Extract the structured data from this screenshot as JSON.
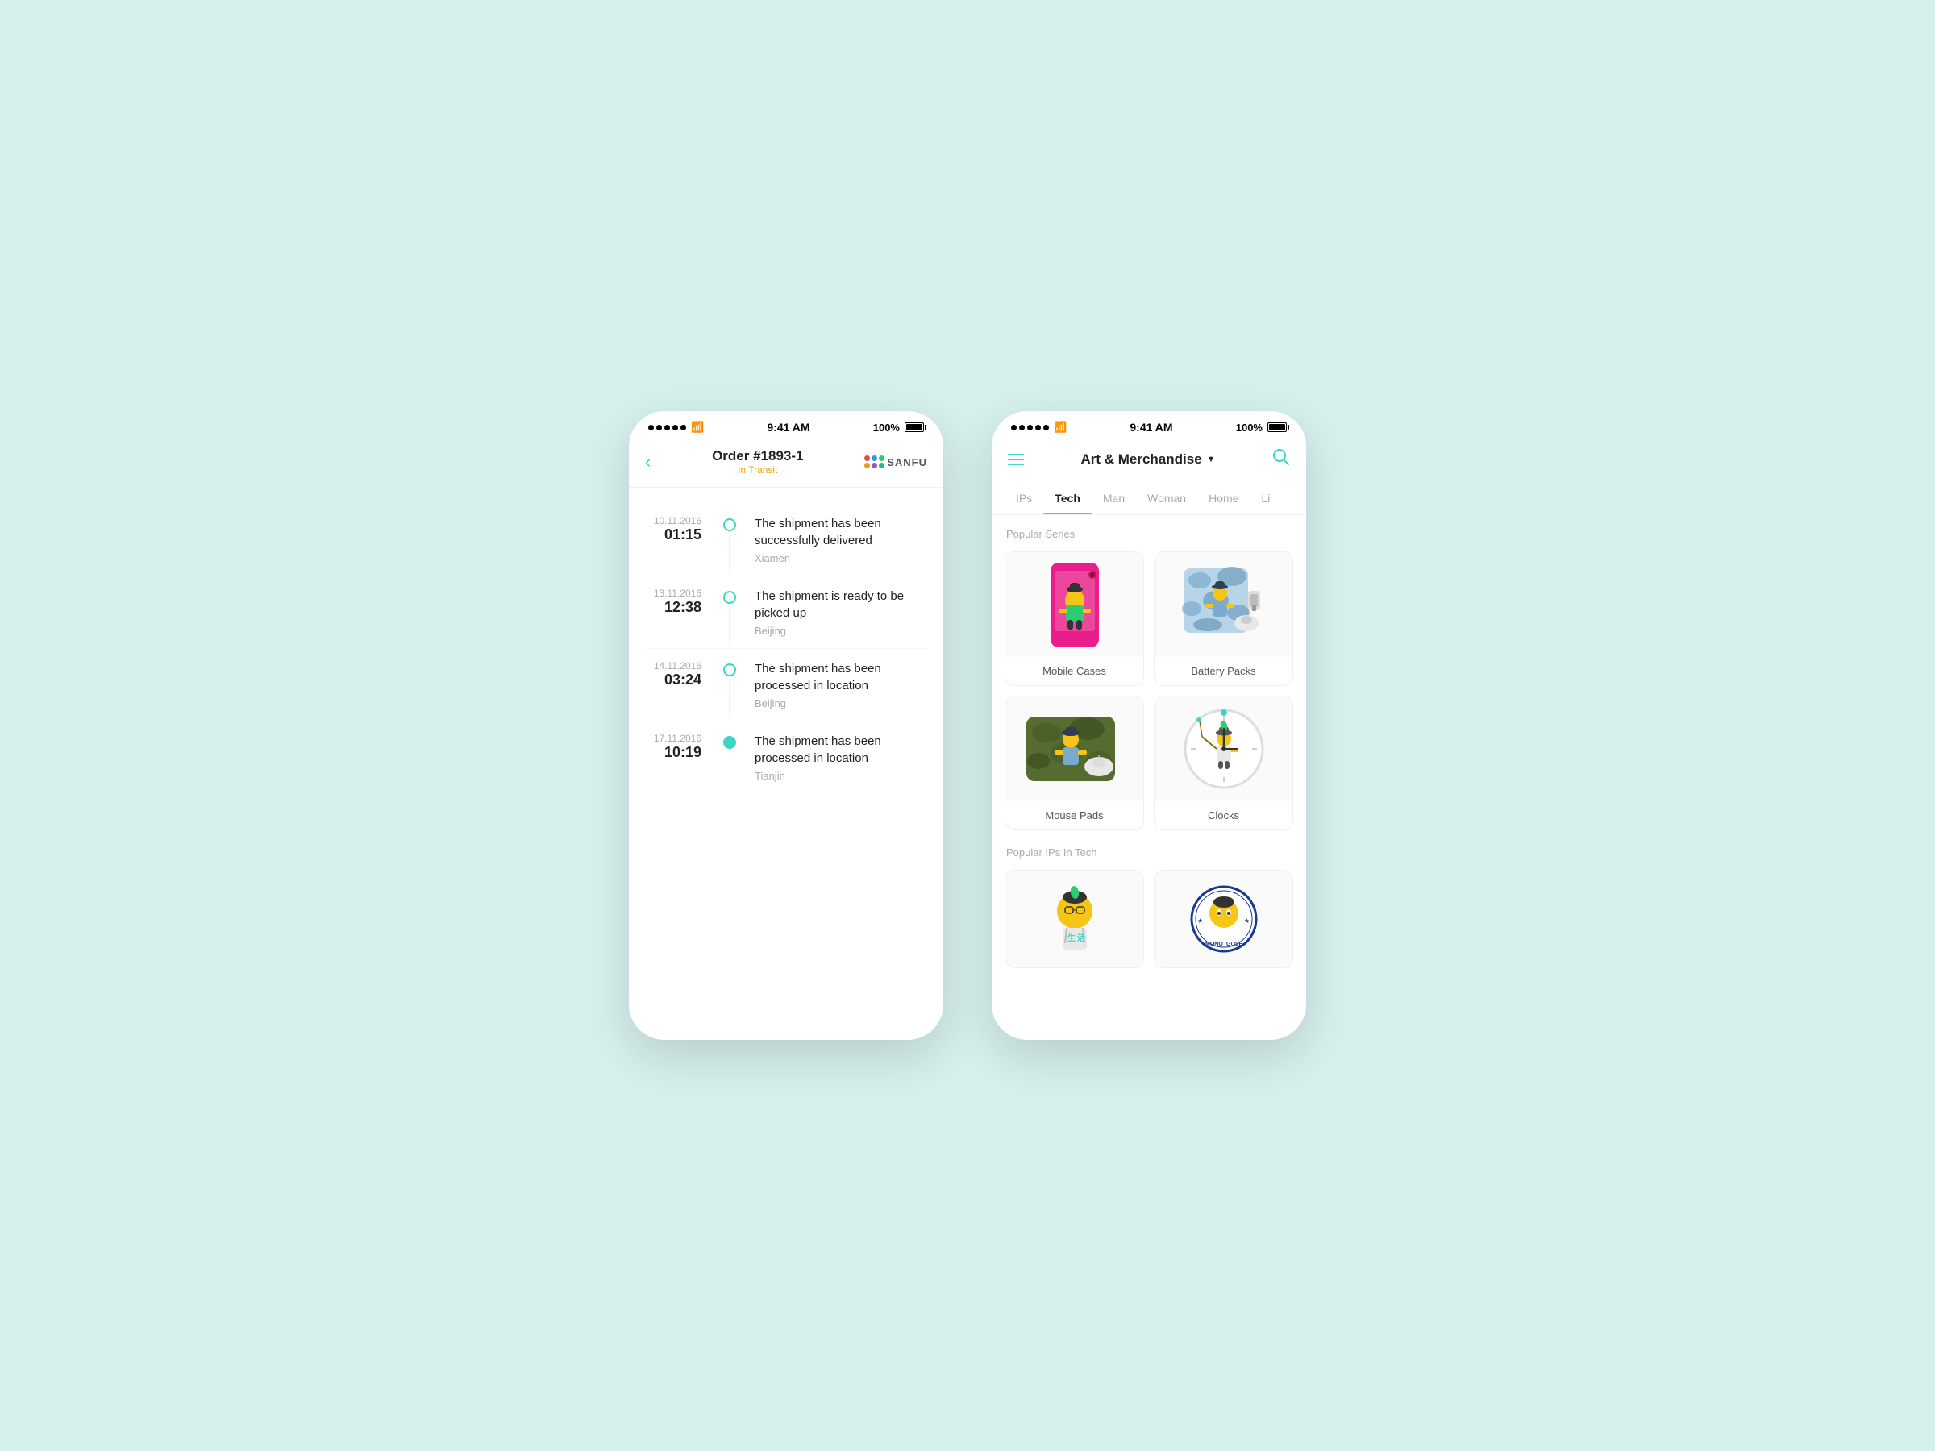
{
  "colors": {
    "teal": "#3dd6c4",
    "background": "#d6f0ee",
    "orange": "#f0a500",
    "text_dark": "#222222",
    "text_light": "#aaaaaa",
    "border": "#f0f0f0"
  },
  "left_phone": {
    "status_bar": {
      "time": "9:41 AM",
      "battery": "100%"
    },
    "header": {
      "back_label": "‹",
      "title": "Order #1893-1",
      "status": "In Transit",
      "brand": "SANFU"
    },
    "timeline": [
      {
        "date": "10.11.2016",
        "time": "01:15",
        "event": "The shipment has been successfully delivered",
        "location": "Xiamen",
        "active": false
      },
      {
        "date": "13.11.2016",
        "time": "12:38",
        "event": "The shipment is ready to be picked up",
        "location": "Beijing",
        "active": false
      },
      {
        "date": "14.11.2016",
        "time": "03:24",
        "event": "The shipment has been processed in location",
        "location": "Beijing",
        "active": false
      },
      {
        "date": "17.11.2016",
        "time": "10:19",
        "event": "The shipment has been processed in location",
        "location": "Tianjin",
        "active": true
      }
    ]
  },
  "right_phone": {
    "status_bar": {
      "time": "9:41 AM",
      "battery": "100%"
    },
    "header": {
      "title": "Art & Merchandise",
      "dropdown_arrow": "▼"
    },
    "tabs": [
      {
        "label": "IPs",
        "active": false
      },
      {
        "label": "Tech",
        "active": true
      },
      {
        "label": "Man",
        "active": false
      },
      {
        "label": "Woman",
        "active": false
      },
      {
        "label": "Home",
        "active": false
      },
      {
        "label": "Li",
        "active": false
      }
    ],
    "popular_series_label": "Popular Series",
    "products": [
      {
        "name": "Mobile Cases",
        "type": "mobile-case"
      },
      {
        "name": "Battery Packs",
        "type": "battery-pack"
      },
      {
        "name": "Mouse Pads",
        "type": "mouse-pad"
      },
      {
        "name": "Clocks",
        "type": "clock"
      }
    ],
    "popular_ips_label": "Popular IPs In Tech",
    "ip_cards": [
      {
        "type": "character-1"
      },
      {
        "type": "character-2"
      }
    ]
  }
}
